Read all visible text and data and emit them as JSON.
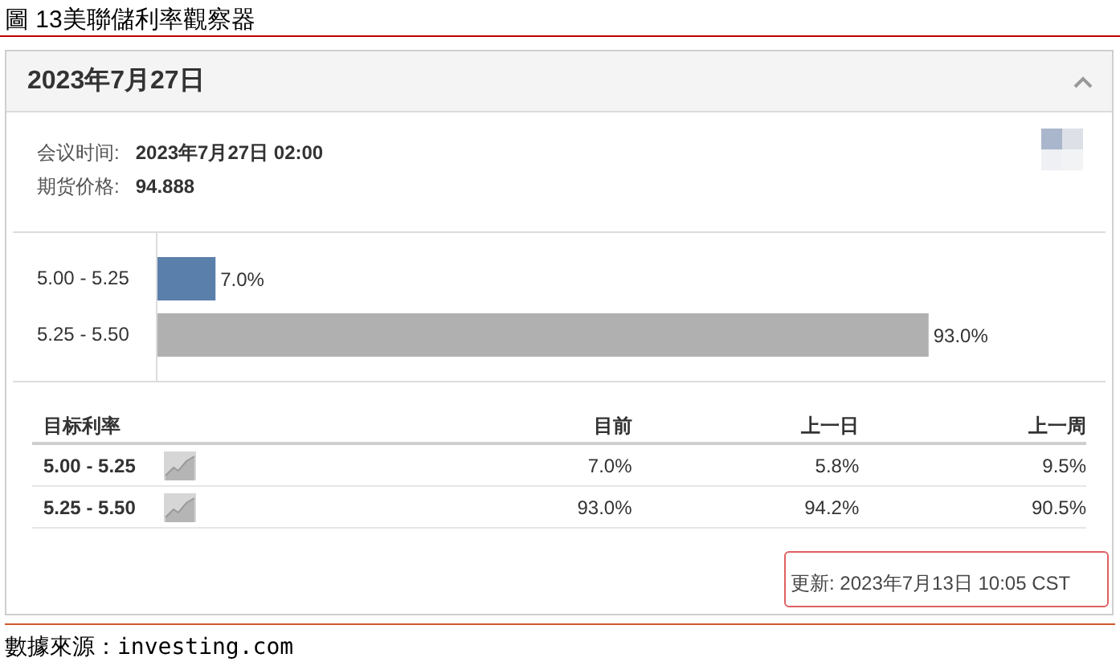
{
  "caption": "圖 13美聯儲利率觀察器",
  "widget": {
    "title": "2023年7月27日",
    "expanded": true,
    "info": [
      {
        "label": "会议时间:",
        "value": "2023年7月27日 02:00"
      },
      {
        "label": "期货价格:",
        "value": "94.888"
      }
    ],
    "chart_data": {
      "type": "bar",
      "orientation": "horizontal",
      "categories": [
        "5.00 - 5.25",
        "5.25 - 5.50"
      ],
      "series": [
        {
          "color": "#5b7fab",
          "values": [
            7.0,
            null
          ],
          "value_labels": [
            "7.0%",
            null
          ]
        },
        {
          "color": "#b0b0b0",
          "values": [
            null,
            93.0
          ],
          "value_labels": [
            null,
            "93.0%"
          ]
        }
      ]
    },
    "table": {
      "columns": [
        "目标利率",
        "目前",
        "上一日",
        "上一周"
      ],
      "rows": [
        {
          "cells": [
            "5.00 - 5.25",
            "7.0%",
            "5.8%",
            "9.5%"
          ]
        },
        {
          "cells": [
            "5.25 - 5.50",
            "93.0%",
            "94.2%",
            "90.5%"
          ]
        }
      ]
    },
    "updated": "更新: 2023年7月13日 10:05 CST"
  },
  "source": "數據來源：investing.com"
}
